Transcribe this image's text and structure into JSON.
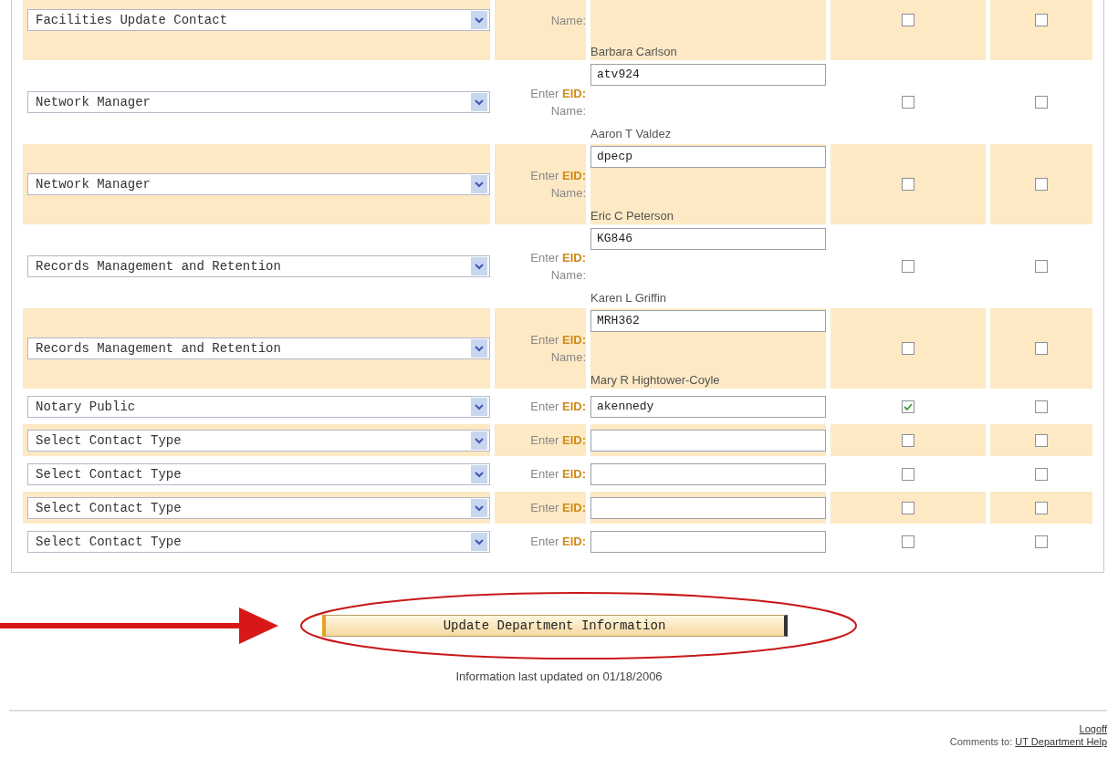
{
  "contacts": [
    {
      "contact_type": "Facilities Update Contact",
      "name_label": "Name:",
      "name": "Barbara Carlson",
      "checkbox_1": false,
      "checkbox_2": false
    },
    {
      "contact_type": "Network Manager",
      "eid_label": "Enter **EID:**",
      "eid": "atv924",
      "name_label": "Name:",
      "name": "Aaron T Valdez",
      "checkbox_1": false,
      "checkbox_2": false
    },
    {
      "contact_type": "Network Manager",
      "eid_label": "Enter **EID:**",
      "eid": "dpecp",
      "name_label": "Name:",
      "name": "Eric C Peterson",
      "checkbox_1": false,
      "checkbox_2": false
    },
    {
      "contact_type": "Records Management and Retention",
      "eid_label": "Enter **EID:**",
      "eid": "KG846",
      "name_label": "Name:",
      "name": "Karen L Griffin",
      "checkbox_1": false,
      "checkbox_2": false
    },
    {
      "contact_type": "Records Management and Retention",
      "eid_label": "Enter **EID:**",
      "eid": "MRH362",
      "name_label": "Name:",
      "name": "Mary R Hightower-Coyle",
      "checkbox_1": false,
      "checkbox_2": false
    },
    {
      "contact_type": "Notary Public",
      "eid_label": "Enter **EID:**",
      "eid": "akennedy",
      "checkbox_1": true,
      "checkbox_2": false
    },
    {
      "contact_type": "Select Contact Type",
      "eid_label": "Enter **EID:**",
      "checkbox_1": false,
      "checkbox_2": false
    },
    {
      "contact_type": "Select Contact Type",
      "eid_label": "Enter **EID:**",
      "checkbox_1": false,
      "checkbox_2": false
    },
    {
      "contact_type": "Select Contact Type",
      "eid_label": "Enter **EID:**",
      "checkbox_1": false,
      "checkbox_2": false
    },
    {
      "contact_type": "Select Contact Type",
      "eid_label": "Enter **EID:**",
      "checkbox_1": false,
      "checkbox_2": false
    }
  ],
  "update_button": "Update Department Information",
  "last_updated": "Information last updated on 01/18/2006",
  "footer": {
    "logoff": "Logoff",
    "comments_label": "Comments to:",
    "help_link": "UT Department Help"
  }
}
